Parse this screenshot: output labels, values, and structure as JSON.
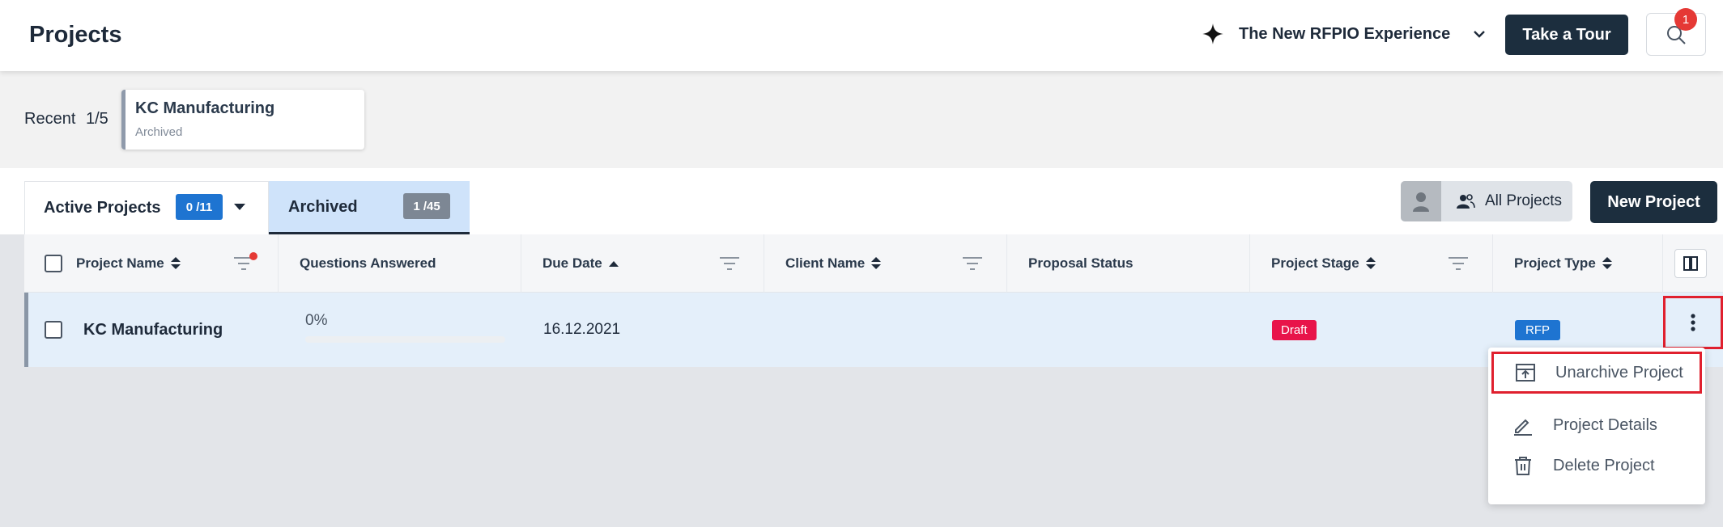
{
  "header": {
    "title": "Projects",
    "experience_label": "The New RFPIO Experience",
    "tour_button": "Take a Tour",
    "notification_count": "1"
  },
  "recent": {
    "label": "Recent",
    "count": "1/5",
    "card": {
      "name": "KC Manufacturing",
      "status": "Archived"
    }
  },
  "tabs": {
    "active": {
      "label": "Active Projects",
      "count": "0 /11"
    },
    "archived": {
      "label": "Archived",
      "count": "1 /45"
    }
  },
  "toolbar": {
    "all_projects_label": "All Projects",
    "new_project_label": "New Project"
  },
  "table": {
    "columns": [
      "Project Name",
      "Questions Answered",
      "Due Date",
      "Client Name",
      "Proposal Status",
      "Project Stage",
      "Project Type"
    ],
    "rows": [
      {
        "project_name": "KC Manufacturing",
        "questions_answered": "0%",
        "questions_answered_value": 0,
        "due_date": "16.12.2021",
        "client_name": "",
        "proposal_status": "",
        "project_stage": "Draft",
        "project_type": "RFP"
      }
    ]
  },
  "row_menu": {
    "items": [
      "Unarchive Project",
      "Project Details",
      "Delete Project"
    ]
  },
  "colors": {
    "brand_dark": "#1c2e3e",
    "accent_blue": "#1e74d1",
    "draft_red": "#e8144a",
    "highlight_red": "#e0202e"
  }
}
